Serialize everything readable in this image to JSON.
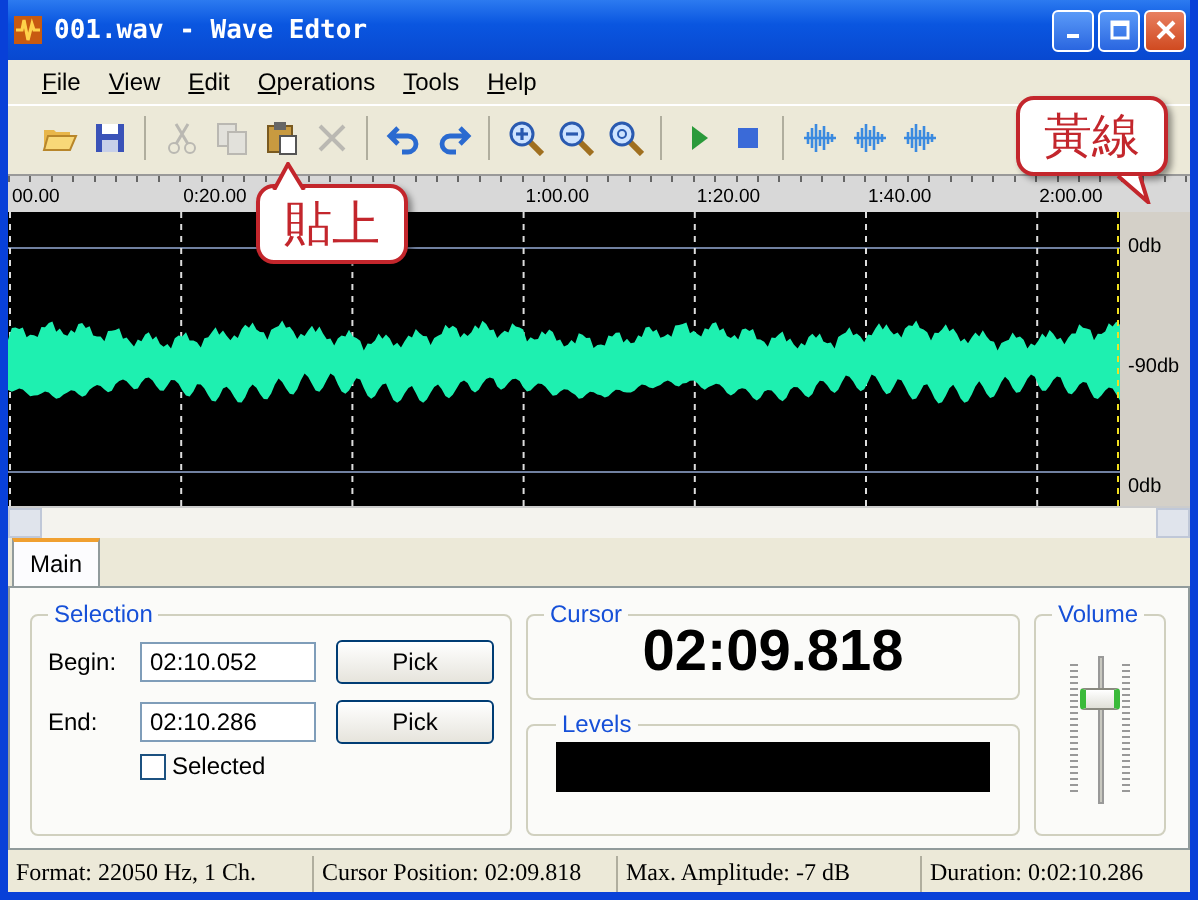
{
  "window": {
    "title": "001.wav - Wave Edtor"
  },
  "menu": [
    "File",
    "View",
    "Edit",
    "Operations",
    "Tools",
    "Help"
  ],
  "toolbar": [
    {
      "kind": "open",
      "disabled": false
    },
    {
      "kind": "save",
      "disabled": false
    },
    {
      "kind": "sep"
    },
    {
      "kind": "cut",
      "disabled": true
    },
    {
      "kind": "copy",
      "disabled": true
    },
    {
      "kind": "paste",
      "disabled": false
    },
    {
      "kind": "delete",
      "disabled": true
    },
    {
      "kind": "sep"
    },
    {
      "kind": "undo",
      "disabled": false
    },
    {
      "kind": "redo",
      "disabled": false
    },
    {
      "kind": "sep"
    },
    {
      "kind": "zoomin",
      "disabled": false
    },
    {
      "kind": "zoomout",
      "disabled": false
    },
    {
      "kind": "zoomfit",
      "disabled": false
    },
    {
      "kind": "sep"
    },
    {
      "kind": "play",
      "disabled": false
    },
    {
      "kind": "stop",
      "disabled": false
    },
    {
      "kind": "sep"
    },
    {
      "kind": "wave",
      "disabled": false
    },
    {
      "kind": "wave",
      "disabled": false
    },
    {
      "kind": "wave",
      "disabled": false
    }
  ],
  "ruler": {
    "labels": [
      "00.00",
      "0:20.00",
      "1:00.00",
      "1:20.00",
      "1:40.00",
      "2:00.00"
    ]
  },
  "scale": [
    "0db",
    "-90db",
    "0db"
  ],
  "callouts": [
    {
      "text": "貼上"
    },
    {
      "text": "黃線"
    }
  ],
  "tabs": [
    {
      "label": "Main",
      "selected": true
    }
  ],
  "selection": {
    "title": "Selection",
    "begin_label": "Begin:",
    "begin": "02:10.052",
    "end_label": "End:",
    "end": "02:10.286",
    "begin_pick": "Pick",
    "end_pick": "Pick",
    "selected_label": "Selected",
    "checked": false
  },
  "cursor": {
    "title": "Cursor",
    "value": "02:09.818"
  },
  "levels": {
    "title": "Levels"
  },
  "volume": {
    "title": "Volume",
    "level": 0.75
  },
  "status_bar": [
    "Format: 22050 Hz, 1 Ch.",
    "Cursor Position: 02:09.818",
    "Max. Amplitude: -7 dB",
    "Duration: 0:02:10.286"
  ]
}
